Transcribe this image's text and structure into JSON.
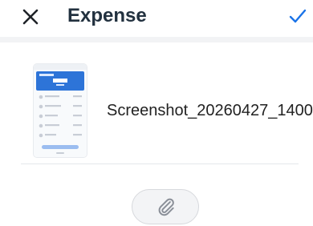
{
  "header": {
    "close_icon": "close-icon",
    "title": "Expense",
    "confirm_icon": "checkmark-icon",
    "accent_color": "#1a73e8"
  },
  "attachment": {
    "file_name": "Screenshot_20260427_1400...",
    "thumbnail_icon": "image-thumbnail"
  },
  "actions": {
    "attach_icon": "paperclip-icon"
  }
}
